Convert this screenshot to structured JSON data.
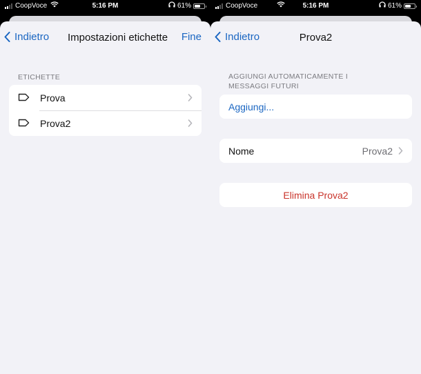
{
  "status_left": {
    "carrier": "CoopVoce",
    "time": "5:16 PM",
    "battery": "61%",
    "battery_level": 0.61
  },
  "status_right": {
    "carrier": "CoopVoce",
    "time": "5:16 PM",
    "battery": "61%",
    "battery_level": 0.61
  },
  "left_screen": {
    "back_label": "Indietro",
    "title": "Impostazioni etichette",
    "done_label": "Fine",
    "section_header": "ETICHETTE",
    "labels": [
      {
        "name": "Prova",
        "icon": "label-tag-icon"
      },
      {
        "name": "Prova2",
        "icon": "label-tag-icon"
      }
    ]
  },
  "right_screen": {
    "back_label": "Indietro",
    "title": "Prova2",
    "section_header_line1": "AGGIUNGI AUTOMATICAMENTE I",
    "section_header_line2": "MESSAGGI FUTURI",
    "add_label": "Aggiungi...",
    "name_label": "Nome",
    "name_value": "Prova2",
    "delete_label": "Elimina Prova2"
  },
  "colors": {
    "accent": "#1a66c2",
    "danger": "#c9342b",
    "background": "#f2f2f7"
  }
}
